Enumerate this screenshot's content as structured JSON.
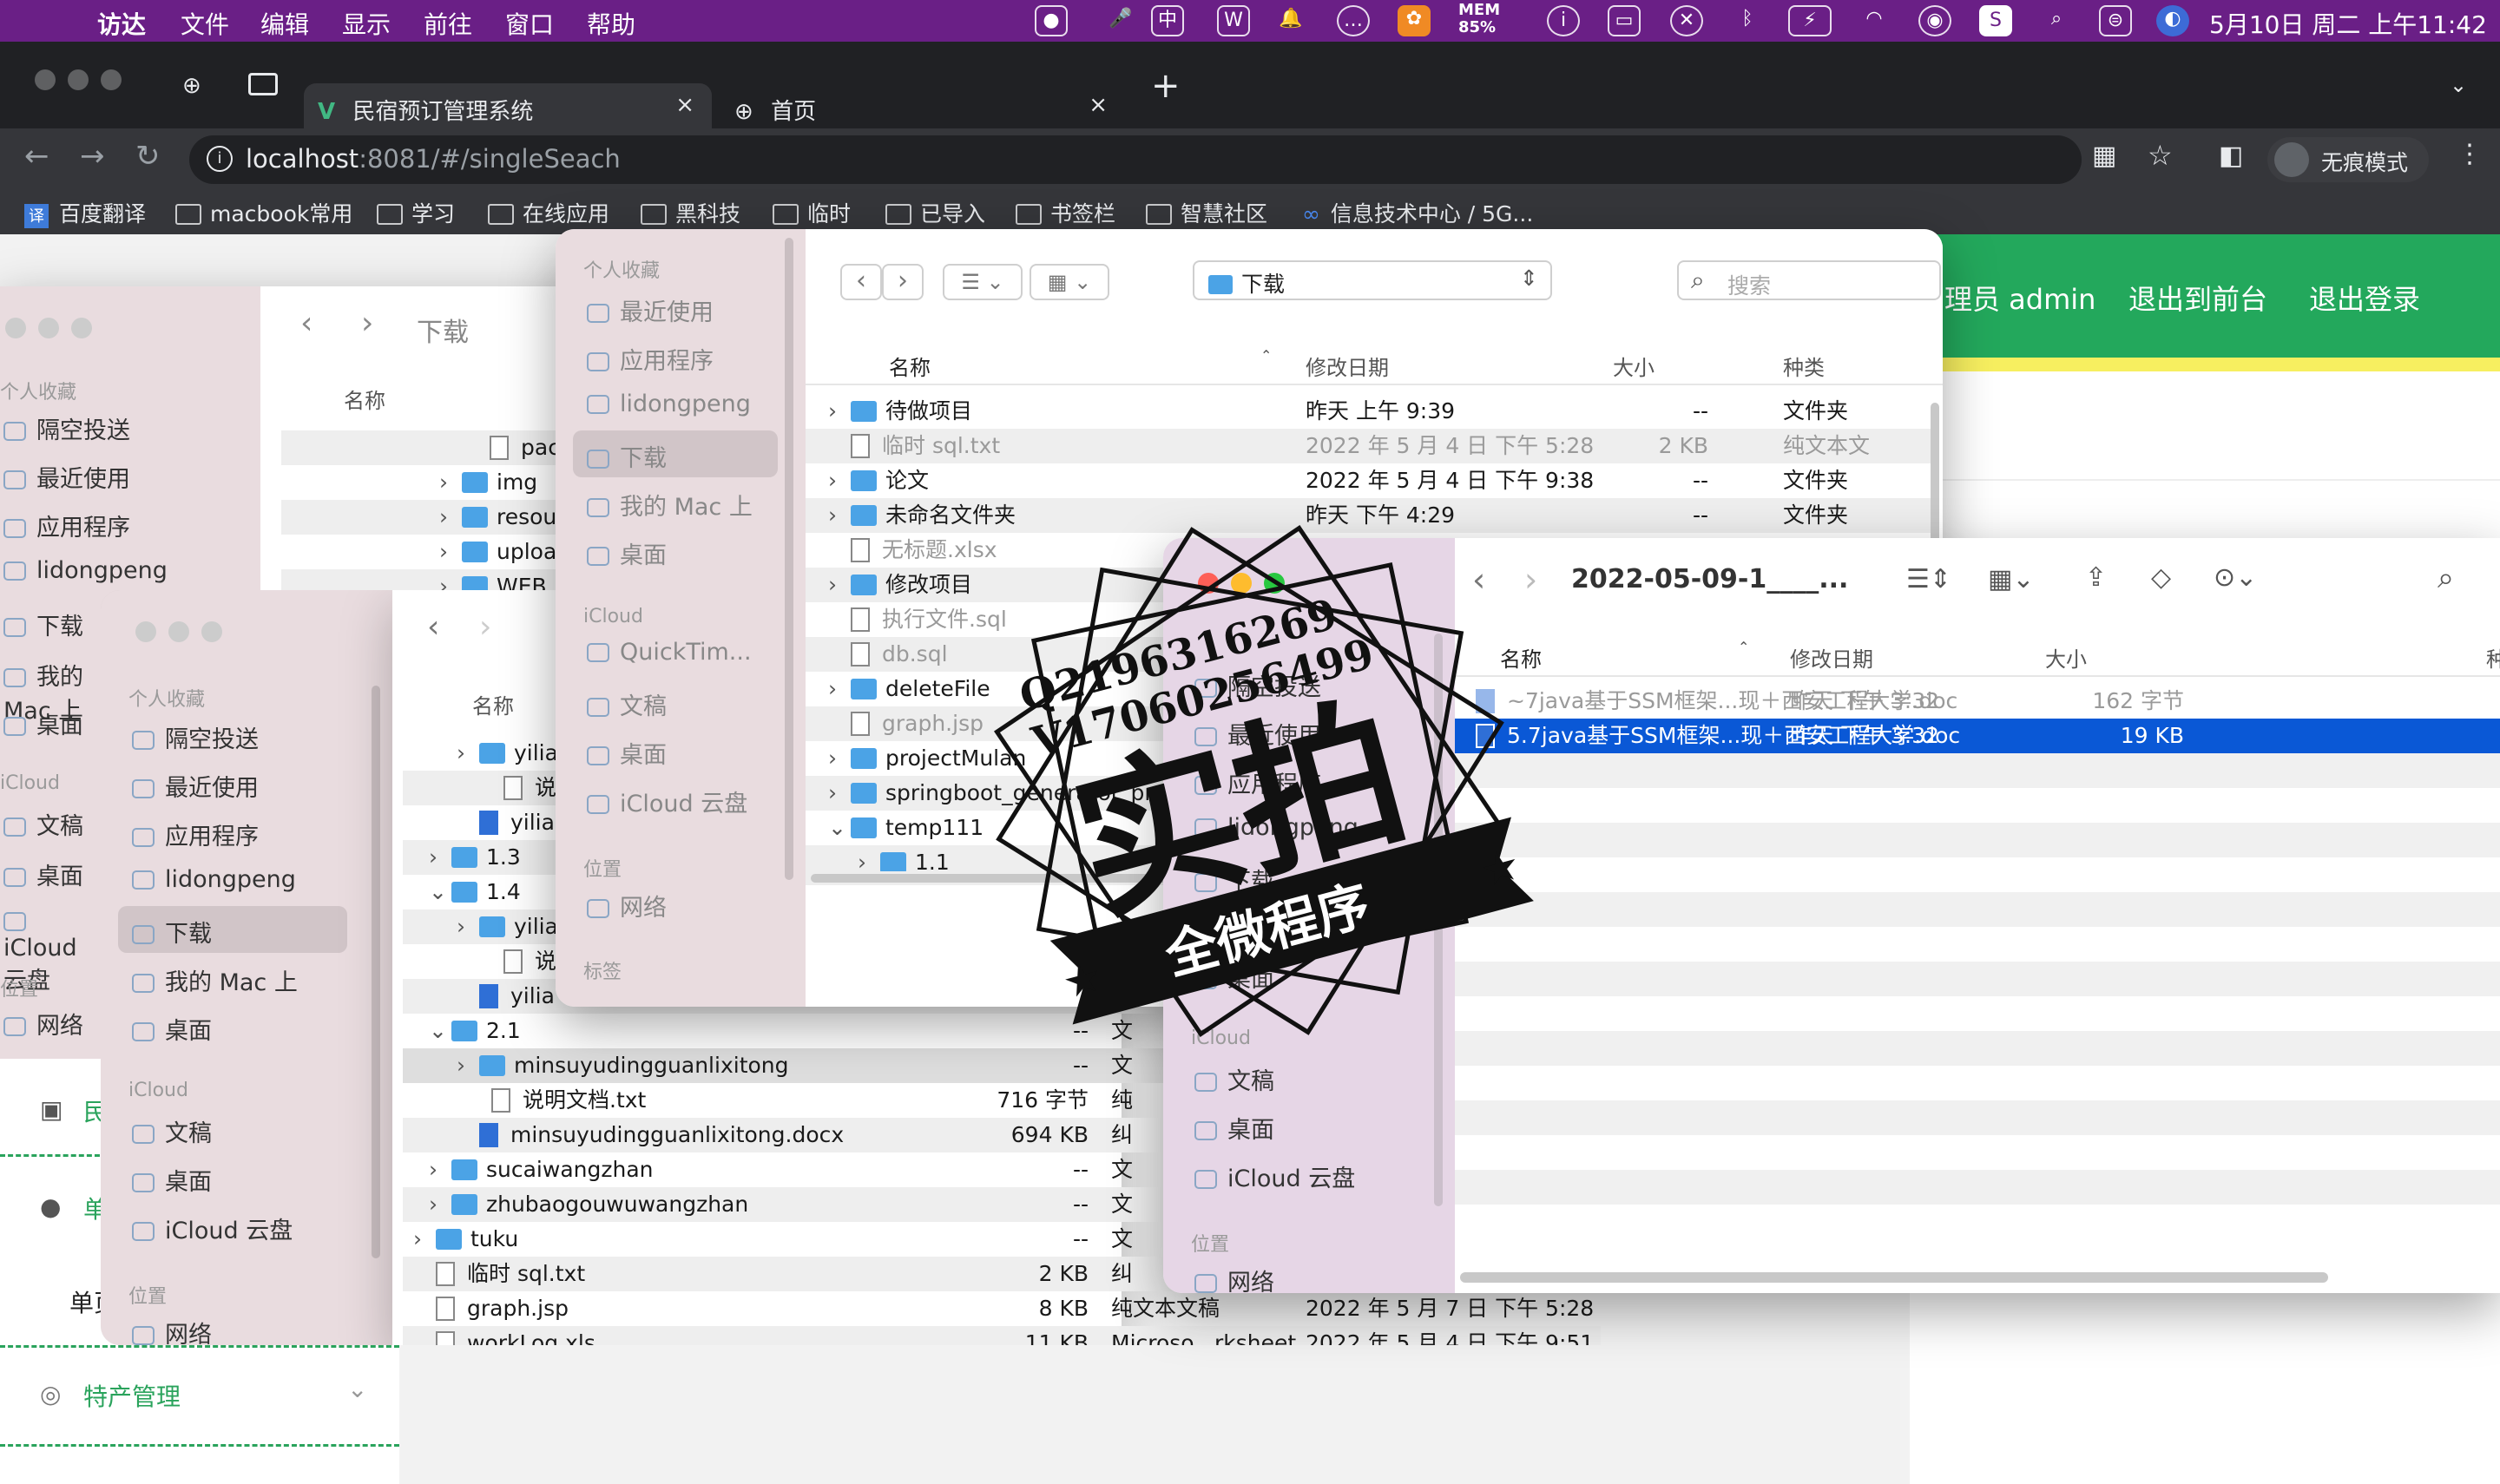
{
  "menubar": {
    "app": "访达",
    "items": [
      "文件",
      "编辑",
      "显示",
      "前往",
      "窗口",
      "帮助"
    ],
    "mem_label": "MEM",
    "mem_value": "85%",
    "clock": "5月10日 周二 上午11:42"
  },
  "browser": {
    "tabs": [
      {
        "title": "民宿预订管理系统",
        "close": "×"
      },
      {
        "title": "首页",
        "close": "×"
      }
    ],
    "new_tab": "+",
    "url_host": "localhost",
    "url_rest": ":8081/#/singleSeach",
    "incognito": "无痕模式",
    "bookmarks": [
      "百度翻译",
      "macbook常用",
      "学习",
      "在线应用",
      "黑科技",
      "临时",
      "已导入",
      "书签栏",
      "智慧社区",
      "信息技术中心 / 5G..."
    ]
  },
  "app_header": {
    "admin": "理员 admin",
    "to_front": "退出到前台",
    "logout": "退出登录"
  },
  "left_nav": {
    "items": [
      "民",
      "单",
      "单页",
      "特产管理"
    ]
  },
  "sidebar_common": {
    "favorites": "个人收藏",
    "icloud": "iCloud",
    "locations": "位置",
    "tags": "标签",
    "airdrop": "隔空投送",
    "recents": "最近使用",
    "apps": "应用程序",
    "user": "lidongpeng",
    "downloads": "下载",
    "mymac": "我的 Mac 上",
    "desktop": "桌面",
    "quicktime": "QuickTim...",
    "documents": "文稿",
    "icloud_drive": "iCloud 云盘",
    "network": "网络"
  },
  "finder_back": {
    "title": "下载",
    "col_name": "名称",
    "rows": [
      "pac",
      "img",
      "resou",
      "uploa",
      "WEB"
    ]
  },
  "finder_mid": {
    "col_name": "名称",
    "rows": [
      {
        "name": "yilia",
        "size": "",
        "kind": ""
      },
      {
        "name": "说明",
        "size": "",
        "kind": ""
      },
      {
        "name": "yilia",
        "size": "",
        "kind": ""
      },
      {
        "name": "1.3",
        "size": "",
        "kind": ""
      },
      {
        "name": "1.4",
        "size": "",
        "kind": ""
      },
      {
        "name": "yilia",
        "size": "",
        "kind": ""
      },
      {
        "name": "说明",
        "size": "",
        "kind": ""
      },
      {
        "name": "yilia",
        "size": "",
        "kind": ""
      },
      {
        "name": "2.1",
        "size": "--",
        "kind": "文"
      },
      {
        "name": "minsuyudingguanlixitong",
        "size": "--",
        "kind": "文"
      },
      {
        "name": "说明文档.txt",
        "size": "716 字节",
        "kind": "纯"
      },
      {
        "name": "minsuyudingguanlixitong.docx",
        "size": "694 KB",
        "kind": "纠"
      },
      {
        "name": "sucaiwangzhan",
        "size": "--",
        "kind": "文"
      },
      {
        "name": "zhubaogouwuwangzhan",
        "size": "--",
        "kind": "文"
      },
      {
        "name": "tuku",
        "size": "--",
        "kind": "文"
      },
      {
        "name": "临时 sql.txt",
        "size": "2 KB",
        "kind": "纠"
      },
      {
        "name": "graph.jsp",
        "size": "8 KB",
        "kind": "纯文本文稿",
        "date": "2022 年 5 月 7 日 下午 5:28"
      },
      {
        "name": "workLog.xls",
        "size": "11 KB",
        "kind": "Microso...rksheet",
        "date": "2022 年 5 月 4 日 下午 9:51"
      }
    ]
  },
  "finder_front": {
    "path": "下载",
    "search_placeholder": "搜索",
    "col_name": "名称",
    "col_date": "修改日期",
    "col_size": "大小",
    "col_kind": "种类",
    "rows": [
      {
        "name": "待做项目",
        "date": "昨天 上午 9:39",
        "size": "--",
        "kind": "文件夹",
        "folder": true
      },
      {
        "name": "临时 sql.txt",
        "date": "2022 年 5 月 4 日 下午 5:28",
        "size": "2 KB",
        "kind": "纯文本文",
        "folder": false,
        "grey": true
      },
      {
        "name": "论文",
        "date": "2022 年 5 月 4 日 下午 9:38",
        "size": "--",
        "kind": "文件夹",
        "folder": true
      },
      {
        "name": "未命名文件夹",
        "date": "昨天 下午 4:29",
        "size": "--",
        "kind": "文件夹",
        "folder": true
      },
      {
        "name": "无标题.xlsx",
        "date": "",
        "size": "",
        "kind": "",
        "folder": false,
        "grey": true
      },
      {
        "name": "修改项目",
        "date": "",
        "size": "",
        "kind": "",
        "folder": true
      },
      {
        "name": "执行文件.sql",
        "date": "",
        "size": "",
        "kind": "",
        "folder": false,
        "grey": true
      },
      {
        "name": "db.sql",
        "date": "",
        "size": "",
        "kind": "",
        "folder": false,
        "grey": true
      },
      {
        "name": "deleteFile",
        "date": "",
        "size": "",
        "kind": "",
        "folder": true
      },
      {
        "name": "graph.jsp",
        "date": "",
        "size": "",
        "kind": "",
        "folder": false,
        "grey": true
      },
      {
        "name": "projectMulan",
        "date": "",
        "size": "",
        "kind": "",
        "folder": true
      },
      {
        "name": "springboot_generator_proj",
        "date": "",
        "size": "",
        "kind": "",
        "folder": true
      },
      {
        "name": "temp111",
        "date": "",
        "size": "",
        "kind": "",
        "folder": true
      },
      {
        "name": "1.1",
        "date": "",
        "size": "",
        "kind": "",
        "folder": true
      }
    ]
  },
  "finder_right": {
    "title": "2022-05-09-1____...",
    "col_name": "名称",
    "col_date": "修改日期",
    "col_size": "大小",
    "col_kind": "种",
    "rows": [
      {
        "name": "~7java基于SSM框架...现＋西安工程大学.doc",
        "date": "昨天 下午 3:32",
        "size": "162 字节",
        "selected": false
      },
      {
        "name": "5.7java基于SSM框架...现＋西安工程大学.doc",
        "date": "昨天 下午 3:32",
        "size": "19 KB",
        "selected": true
      }
    ]
  },
  "watermark": {
    "line1": "Q2196316269",
    "line2": "V17060256499",
    "main": "实拍",
    "ribbon": "全微程序"
  }
}
